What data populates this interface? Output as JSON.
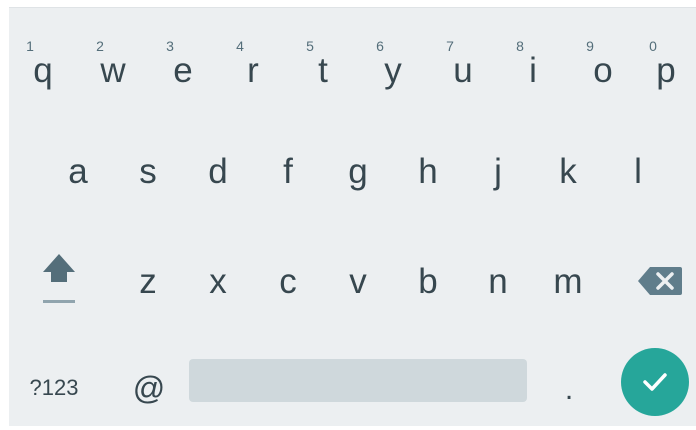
{
  "keyboard": {
    "row1": [
      {
        "label": "q",
        "hint": "1"
      },
      {
        "label": "w",
        "hint": "2"
      },
      {
        "label": "e",
        "hint": "3"
      },
      {
        "label": "r",
        "hint": "4"
      },
      {
        "label": "t",
        "hint": "5"
      },
      {
        "label": "y",
        "hint": "6"
      },
      {
        "label": "u",
        "hint": "7"
      },
      {
        "label": "i",
        "hint": "8"
      },
      {
        "label": "o",
        "hint": "9"
      },
      {
        "label": "p",
        "hint": "0"
      }
    ],
    "row2": [
      "a",
      "s",
      "d",
      "f",
      "g",
      "h",
      "j",
      "k",
      "l"
    ],
    "row3": [
      "z",
      "x",
      "c",
      "v",
      "b",
      "n",
      "m"
    ],
    "bottom": {
      "symbols_label": "?123",
      "at_label": "@",
      "period_label": "."
    },
    "icons": {
      "shift": "shift-icon",
      "backspace": "backspace-icon",
      "done": "checkmark-icon"
    },
    "colors": {
      "background": "#eceff1",
      "key_text": "#37474f",
      "spacebar": "#cfd8dc",
      "action_button": "#26a69a"
    }
  }
}
